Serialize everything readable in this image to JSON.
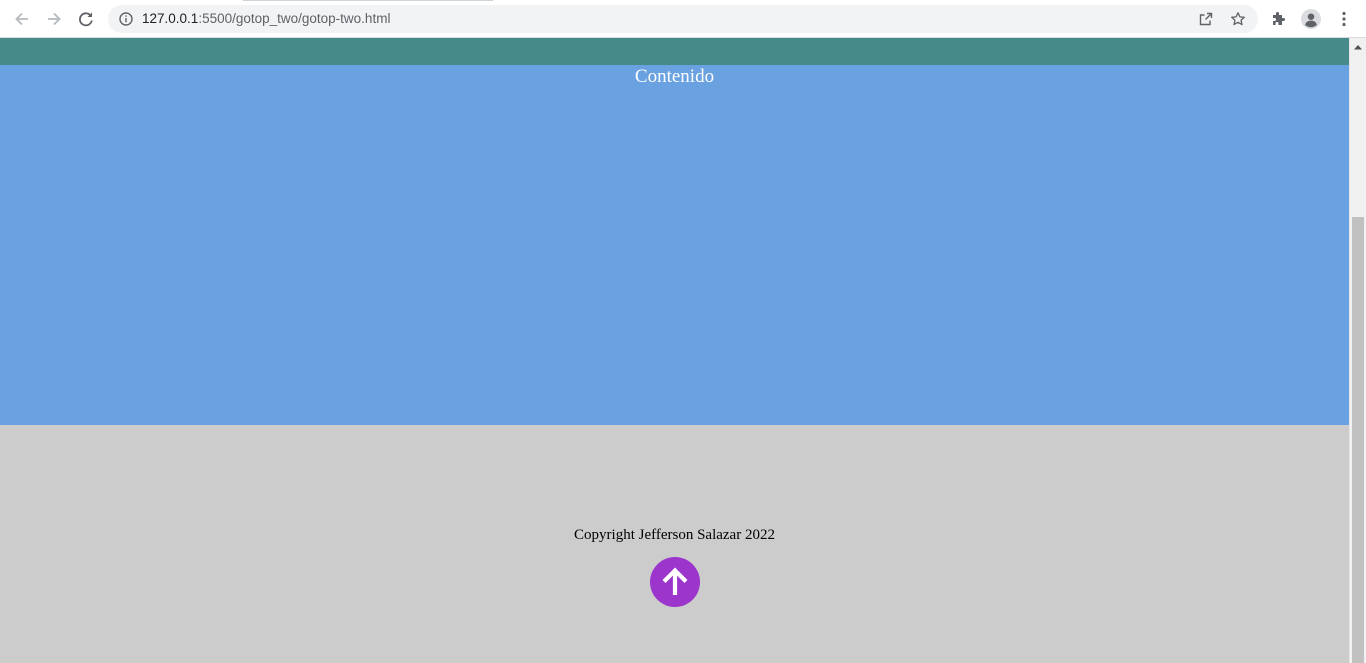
{
  "browser": {
    "url_host": "127.0.0.1",
    "url_rest": ":5500/gotop_two/gotop-two.html"
  },
  "page": {
    "content_title": "Contenido",
    "copyright": "Copyright Jefferson Salazar 2022"
  },
  "colors": {
    "header": "#468a89",
    "content": "#6aa1e0",
    "footer": "#cccccc",
    "gotop_button": "#9b35cc"
  },
  "icons": {
    "back": "arrow-left-icon",
    "forward": "arrow-right-icon",
    "reload": "reload-icon",
    "info": "info-icon",
    "share": "share-icon",
    "star": "star-icon",
    "extensions": "puzzle-icon",
    "profile": "profile-icon",
    "menu": "kebab-menu-icon",
    "gotop": "arrow-up-icon"
  }
}
